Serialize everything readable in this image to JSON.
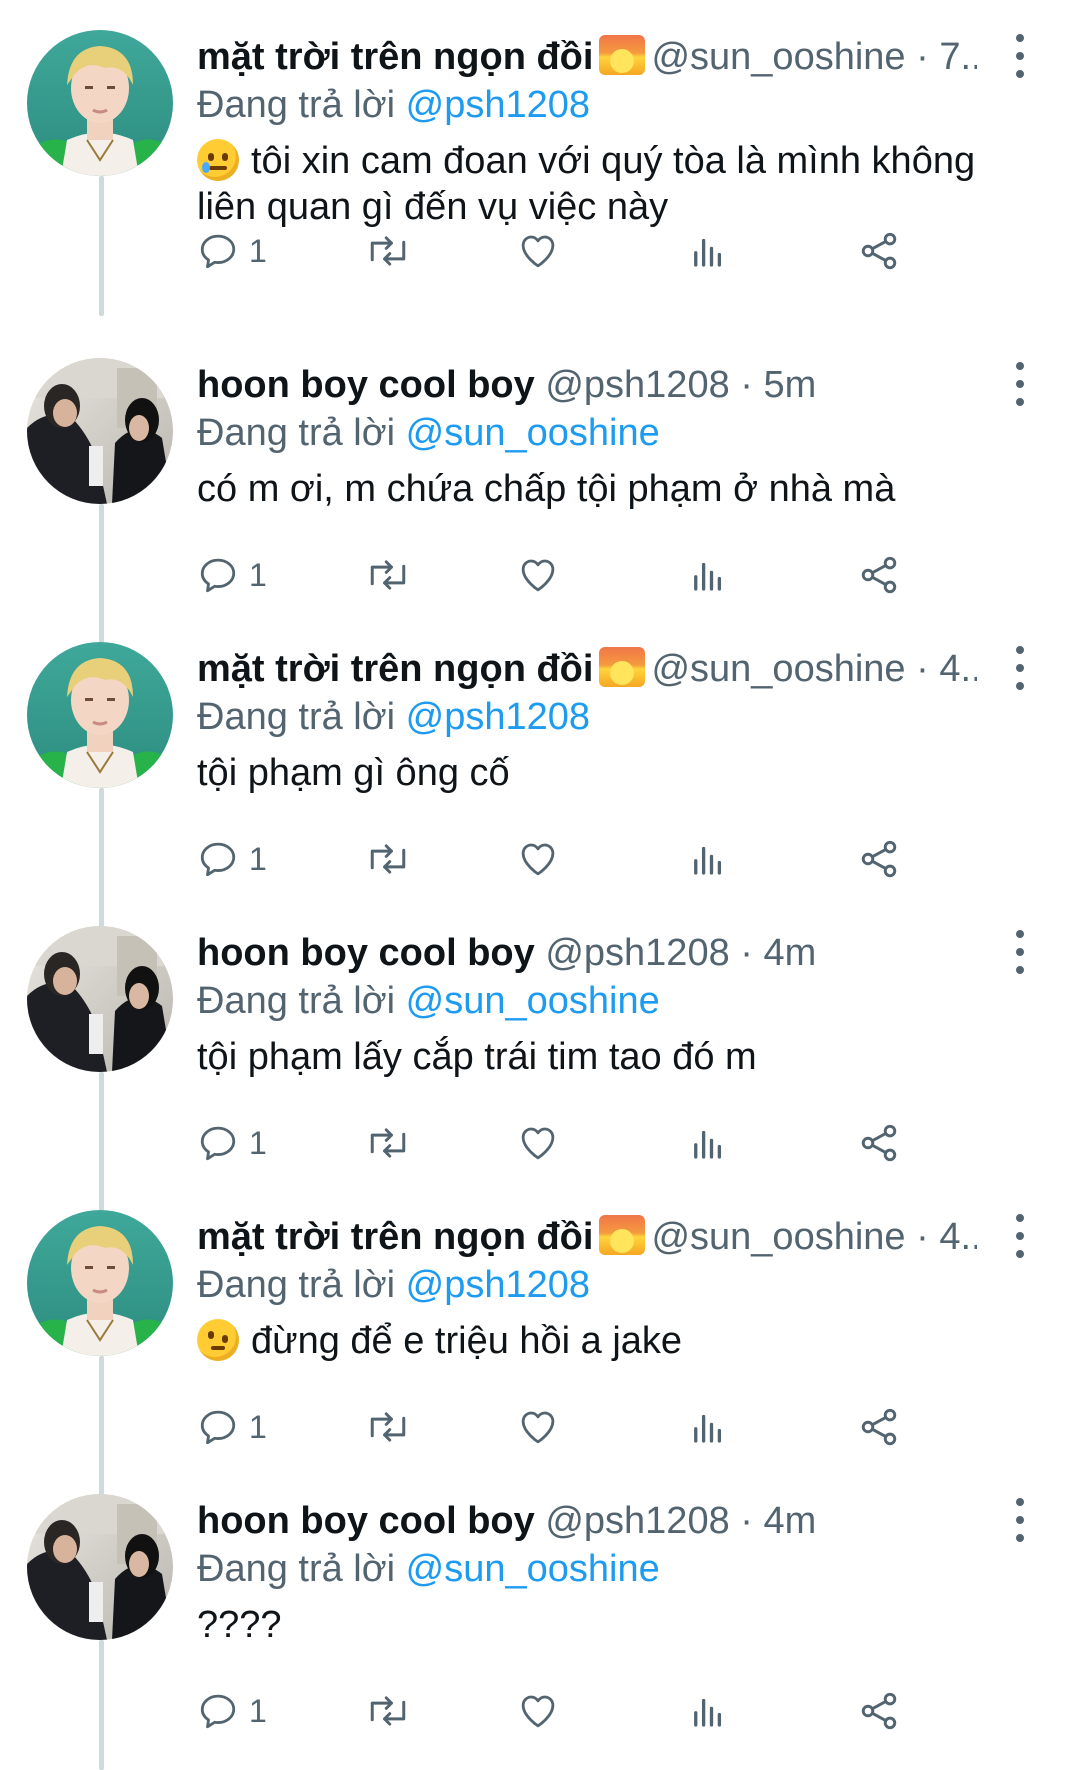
{
  "tweets": [
    {
      "name": "mặt trời trên ngọn đồi",
      "name_emoji": "sunrise-emoji",
      "handle": "@sun_ooshine",
      "time": "· 7...",
      "reply_prefix": "Đang trả lời",
      "reply_to": "@psh1208",
      "text": "tôi xin cam đoan với quý tòa là mình không liên quan gì đến vụ việc này",
      "text_emoji": "smiling-face-with-tear-emoji",
      "reply_count": "1",
      "avatar": "blonde-avatar"
    },
    {
      "name": "hoon boy cool boy",
      "handle": "@psh1208",
      "time": "· 5m",
      "reply_prefix": "Đang trả lời",
      "reply_to": "@sun_ooshine",
      "text": "có m ơi, m chứa chấp tội phạm ở nhà mà",
      "reply_count": "1",
      "avatar": "photo-avatar"
    },
    {
      "name": "mặt trời trên ngọn đồi",
      "name_emoji": "sunrise-emoji",
      "handle": "@sun_ooshine",
      "time": "· 4...",
      "reply_prefix": "Đang trả lời",
      "reply_to": "@psh1208",
      "text": "tội phạm gì ông cố",
      "reply_count": "1",
      "avatar": "blonde-avatar"
    },
    {
      "name": "hoon boy cool boy",
      "handle": "@psh1208",
      "time": "· 4m",
      "reply_prefix": "Đang trả lời",
      "reply_to": "@sun_ooshine",
      "text": "tội phạm lấy cắp trái tim tao đó m",
      "reply_count": "1",
      "avatar": "photo-avatar"
    },
    {
      "name": "mặt trời trên ngọn đồi",
      "name_emoji": "sunrise-emoji",
      "handle": "@sun_ooshine",
      "time": "· 4...",
      "reply_prefix": "Đang trả lời",
      "reply_to": "@psh1208",
      "text": "đừng để e triệu hồi a jake",
      "text_emoji": "face-with-raised-eyebrow-emoji",
      "reply_count": "1",
      "avatar": "blonde-avatar"
    },
    {
      "name": "hoon boy cool boy",
      "handle": "@psh1208",
      "time": "· 4m",
      "reply_prefix": "Đang trả lời",
      "reply_to": "@sun_ooshine",
      "text": "????",
      "reply_count": "1",
      "avatar": "photo-avatar"
    }
  ],
  "icons": {
    "reply": "reply-icon",
    "retweet": "retweet-icon",
    "like": "like-icon",
    "views": "views-icon",
    "share": "share-icon",
    "more": "more-options-icon"
  },
  "colors": {
    "text": "#0f1419",
    "secondary": "#536471",
    "mention": "#1d9bf0",
    "thread_line": "#cfd9de"
  }
}
